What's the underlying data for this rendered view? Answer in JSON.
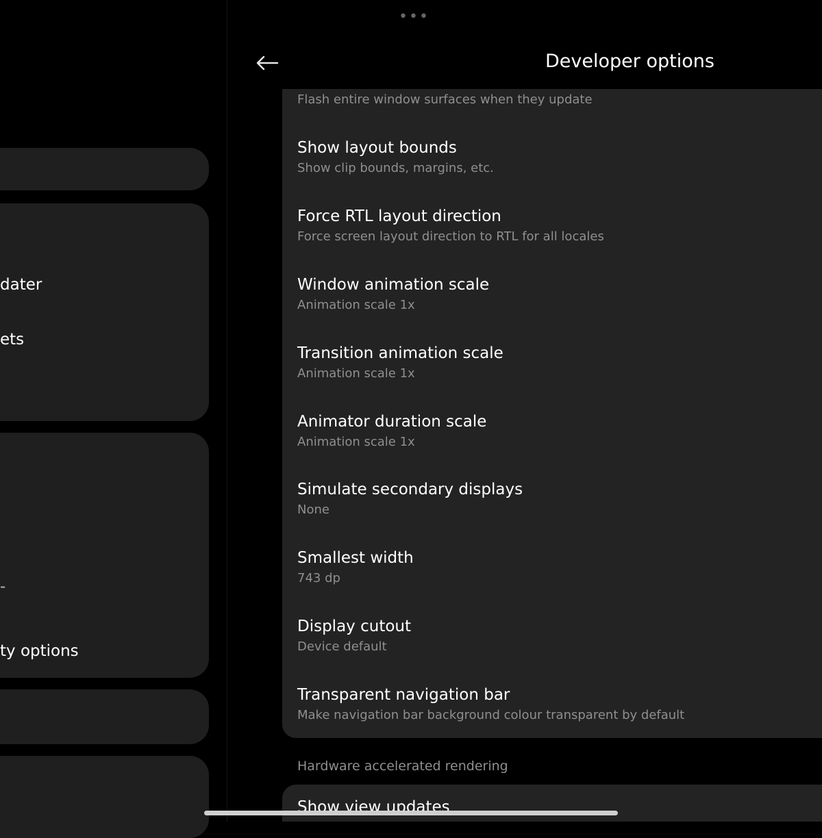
{
  "left_panel": {
    "items": [
      {
        "label": "dater"
      },
      {
        "label": "ets"
      },
      {
        "label": "-"
      },
      {
        "label": "ty options"
      }
    ]
  },
  "header": {
    "title": "Developer options",
    "back_icon": "arrow-left-icon",
    "drag_handle": "•••"
  },
  "settings": [
    {
      "title": "",
      "subtitle": "Flash entire window surfaces when they update"
    },
    {
      "title": "Show layout bounds",
      "subtitle": "Show clip bounds, margins, etc."
    },
    {
      "title": "Force RTL layout direction",
      "subtitle": "Force screen layout direction to RTL for all locales"
    },
    {
      "title": "Window animation scale",
      "subtitle": "Animation scale 1x"
    },
    {
      "title": "Transition animation scale",
      "subtitle": "Animation scale 1x"
    },
    {
      "title": "Animator duration scale",
      "subtitle": "Animation scale 1x"
    },
    {
      "title": "Simulate secondary displays",
      "subtitle": "None"
    },
    {
      "title": "Smallest width",
      "subtitle": "743 dp"
    },
    {
      "title": "Display cutout",
      "subtitle": "Device default"
    },
    {
      "title": "Transparent navigation bar",
      "subtitle": "Make navigation bar background colour transparent by default"
    }
  ],
  "section": {
    "header": "Hardware accelerated rendering",
    "first_item": "Show view updates"
  },
  "colors": {
    "background": "#000000",
    "card": "#232323",
    "subtitle": "#8f8f8f"
  }
}
